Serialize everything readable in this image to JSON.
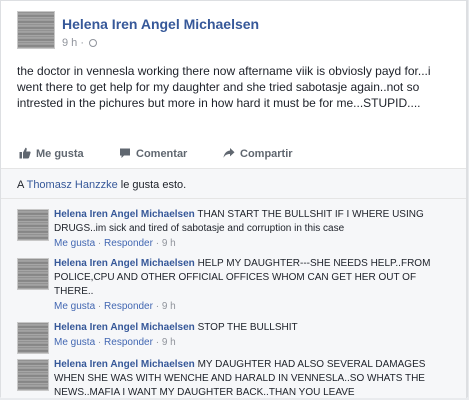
{
  "post": {
    "author": "Helena Iren Angel Michaelsen",
    "timestamp": "9 h",
    "privacy_icon": "globe-icon",
    "text": "the doctor in vennesla working there now aftername viik is obviosly payd for...i went there to get help for my daughter and she tried sabotasje again..not so intrested in the pichures but more in how hard it must be for me...STUPID...."
  },
  "actions": {
    "like_label": "Me gusta",
    "comment_label": "Comentar",
    "share_label": "Compartir"
  },
  "likes": {
    "prefix": "A ",
    "liker": "Thomasz Hanzzke",
    "suffix": " le gusta esto."
  },
  "comments": [
    {
      "author": "Helena Iren Angel Michaelsen",
      "text": "THAN START THE BULLSHIT IF I WHERE USING DRUGS..im sick and tired of sabotasje and corruption in this case",
      "like_label": "Me gusta",
      "reply_label": "Responder",
      "time": "9 h"
    },
    {
      "author": "Helena Iren Angel Michaelsen",
      "text": "HELP MY DAUGHTER---SHE NEEDS HELP..FROM POLICE,CPU AND OTHER OFFICIAL OFFICES WHOM CAN GET HER OUT OF THERE..",
      "like_label": "Me gusta",
      "reply_label": "Responder",
      "time": "9 h"
    },
    {
      "author": "Helena Iren Angel Michaelsen",
      "text": "STOP THE BULLSHIT",
      "like_label": "Me gusta",
      "reply_label": "Responder",
      "time": "9 h"
    },
    {
      "author": "Helena Iren Angel Michaelsen",
      "text": "MY DAUGHTER HAD ALSO SEVERAL DAMAGES WHEN SHE WAS WITH WENCHE AND HARALD IN VENNESLA..SO WHATS THE NEWS..MAFIA I WANT MY DAUGHTER BACK..THAN YOU LEAVE",
      "like_label": "",
      "reply_label": "",
      "time": ""
    }
  ],
  "colors": {
    "link": "#365899",
    "text": "#1d2129",
    "muted": "#90949c",
    "background": "#f6f7f9"
  }
}
